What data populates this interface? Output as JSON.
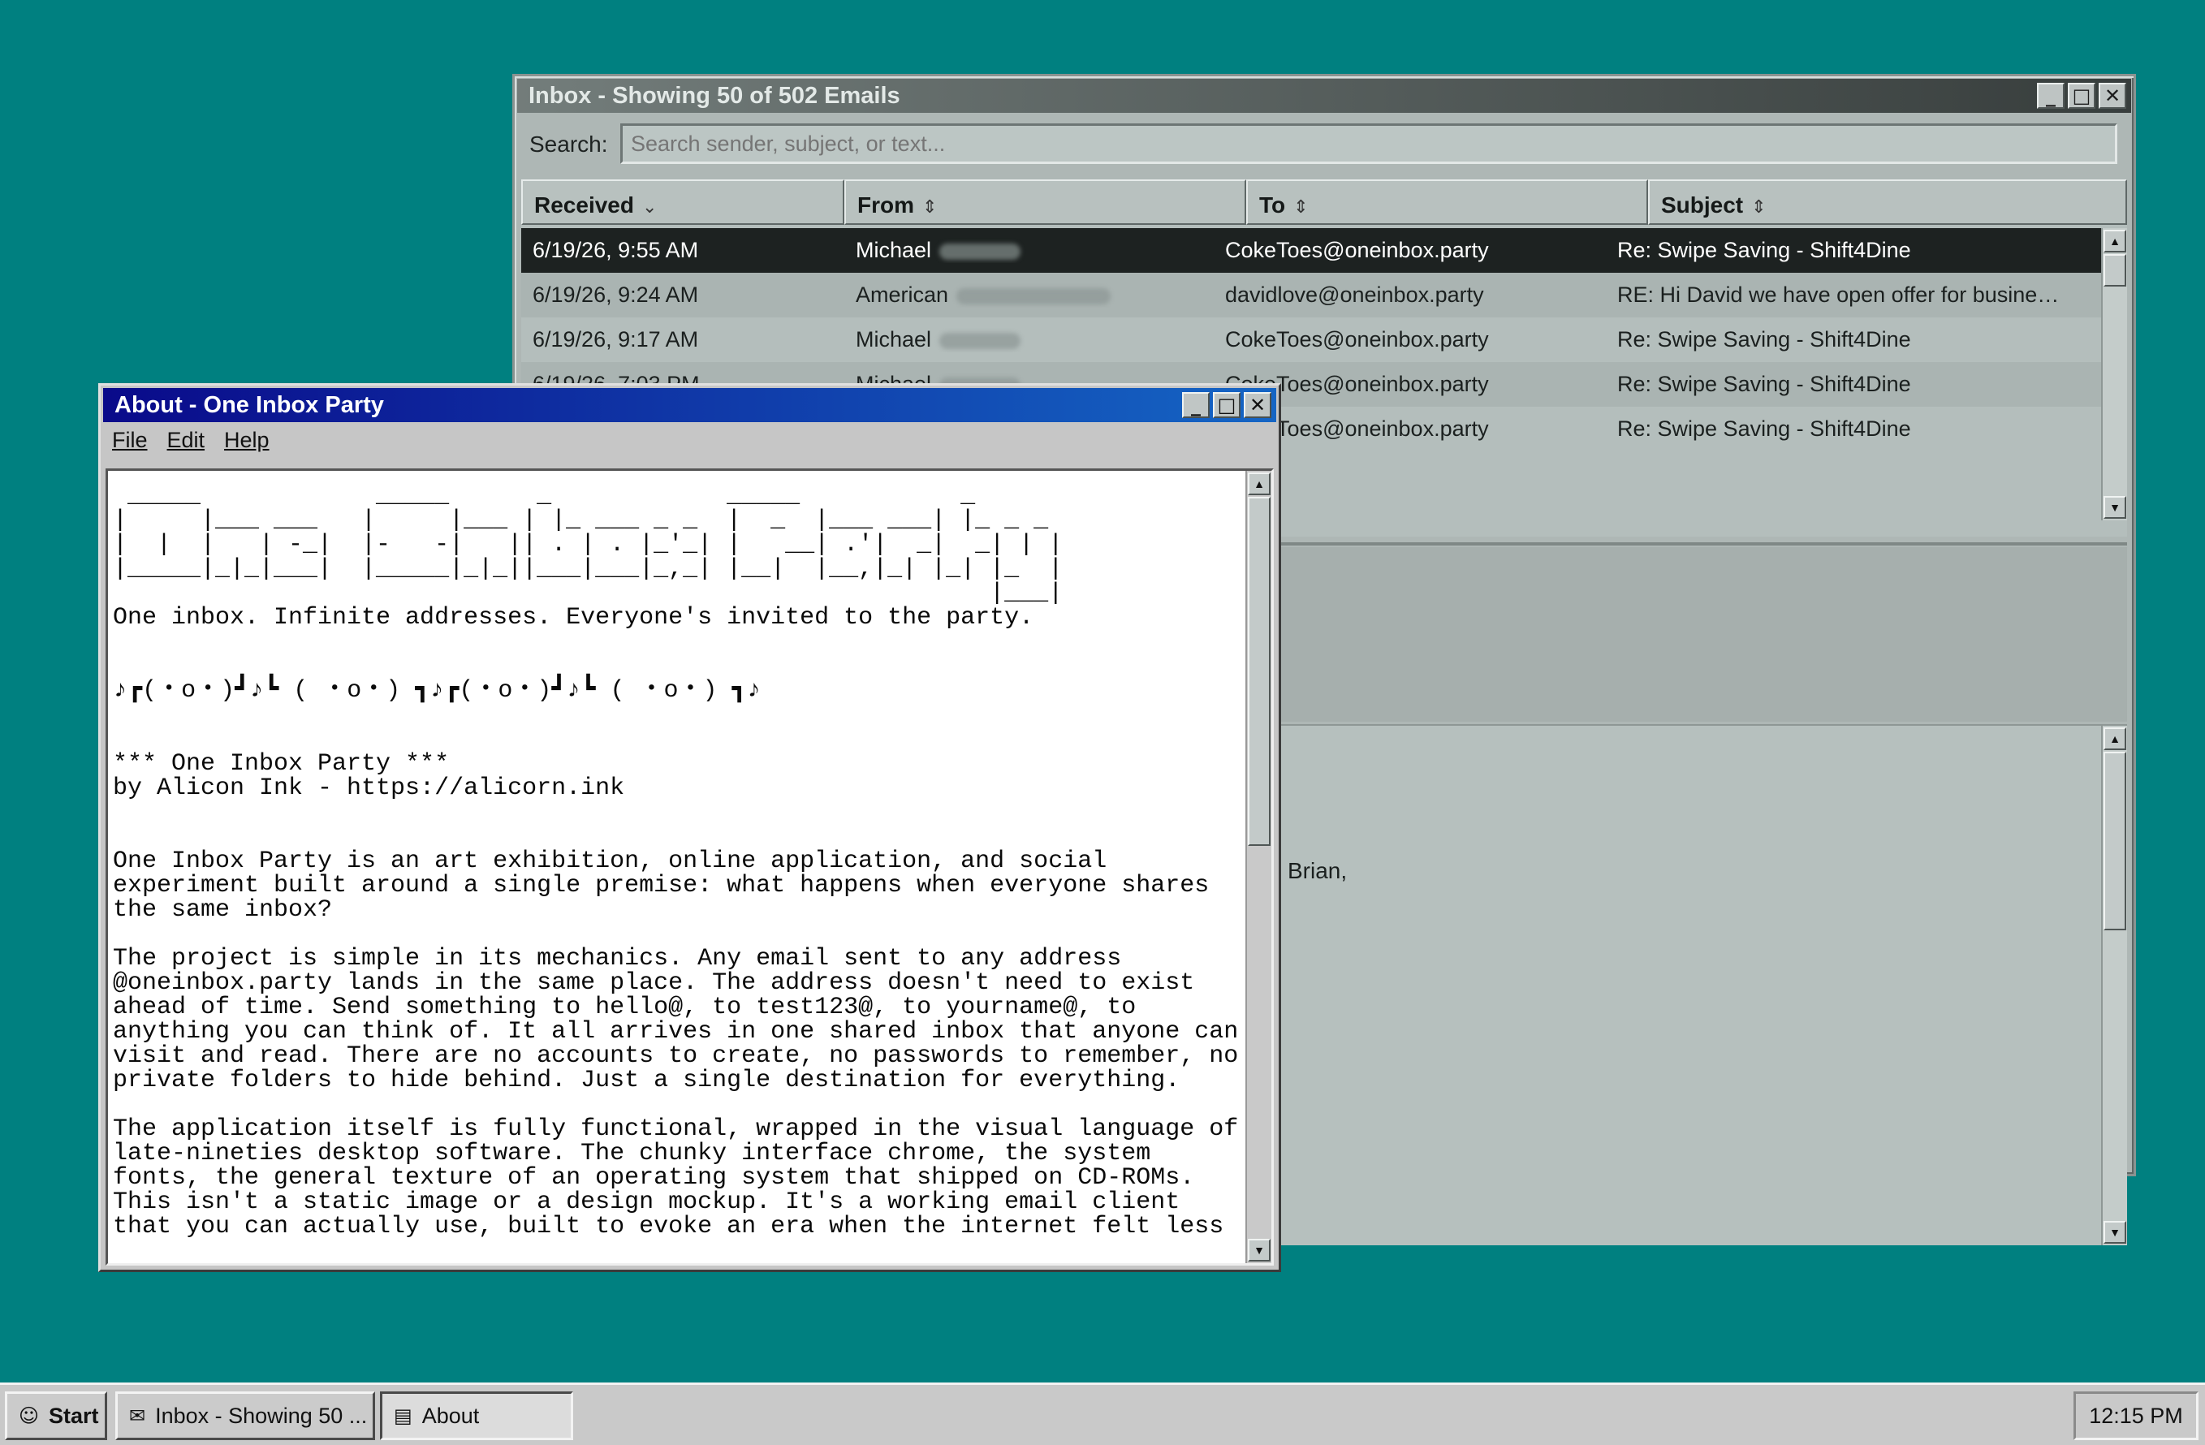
{
  "inbox": {
    "title": "Inbox - Showing 50 of 502 Emails",
    "search_label": "Search:",
    "search_placeholder": "Search sender, subject, or text...",
    "columns": [
      {
        "label": "Received",
        "sort": "⌄"
      },
      {
        "label": "From",
        "sort": "⇕"
      },
      {
        "label": "To",
        "sort": "⇕"
      },
      {
        "label": "Subject",
        "sort": "⇕"
      }
    ],
    "rows": [
      {
        "received": "6/19/26, 9:55 AM",
        "from": "Michael",
        "to": "CokeToes@oneinbox.party",
        "subject": "Re: Swipe Saving - Shift4Dine",
        "selected": true
      },
      {
        "received": "6/19/26, 9:24 AM",
        "from": "American",
        "to": "davidlove@oneinbox.party",
        "subject": "RE: Hi David we have open offer for busine…",
        "selected": false
      },
      {
        "received": "6/19/26, 9:17 AM",
        "from": "Michael",
        "to": "CokeToes@oneinbox.party",
        "subject": "Re: Swipe Saving - Shift4Dine",
        "selected": false
      },
      {
        "received": "6/19/26, 7:03 PM",
        "from": "Michael",
        "to": "CokeToes@oneinbox.party",
        "subject": "Re: Swipe Saving - Shift4Dine",
        "selected": false
      },
      {
        "received": "",
        "from": "",
        "to": "CokeToes@oneinbox.party",
        "subject": "Re: Swipe Saving - Shift4Dine",
        "selected": false
      }
    ],
    "preview_greeting": "Brian,"
  },
  "about": {
    "title": "About - One Inbox Party",
    "menu": {
      "file": "File",
      "edit": "Edit",
      "help": "Help"
    },
    "text": " _____            _____      _            _____           _\n|     |___ ___   |     |___ | |_ ___ _ _  |  _  |___ ___| |_ _ _\n|  |  |   | -_|  |-   -|   || . | . |_'_| |   __| .'|  _|  _| | |\n|_____|_|_|___|  |_____|_|_||___|___|_,_| |__|  |__,|_| |_| |_  |\n                                                            |___|\nOne inbox. Infinite addresses. Everyone's invited to the party.\n\n\n♪┏(・o・)┛♪┗ ( ・o・) ┓♪┏(・o・)┛♪┗ ( ・o・) ┓♪\n\n\n*** One Inbox Party ***\nby Alicon Ink - https://alicorn.ink\n\n\nOne Inbox Party is an art exhibition, online application, and social\nexperiment built around a single premise: what happens when everyone shares\nthe same inbox?\n\nThe project is simple in its mechanics. Any email sent to any address\n@oneinbox.party lands in the same place. The address doesn't need to exist\nahead of time. Send something to hello@, to test123@, to yourname@, to\nanything you can think of. It all arrives in one shared inbox that anyone can\nvisit and read. There are no accounts to create, no passwords to remember, no\nprivate folders to hide behind. Just a single destination for everything.\n\nThe application itself is fully functional, wrapped in the visual language of\nlate-nineties desktop software. The chunky interface chrome, the system\nfonts, the general texture of an operating system that shipped on CD-ROMs.\nThis isn't a static image or a design mockup. It's a working email client\nthat you can actually use, built to evoke an era when the internet felt less"
  },
  "taskbar": {
    "start": "Start",
    "items": [
      {
        "label": "Inbox - Showing 50 ...",
        "icon": "✉"
      },
      {
        "label": "About",
        "icon": "▤"
      }
    ],
    "clock": "12:15 PM"
  }
}
